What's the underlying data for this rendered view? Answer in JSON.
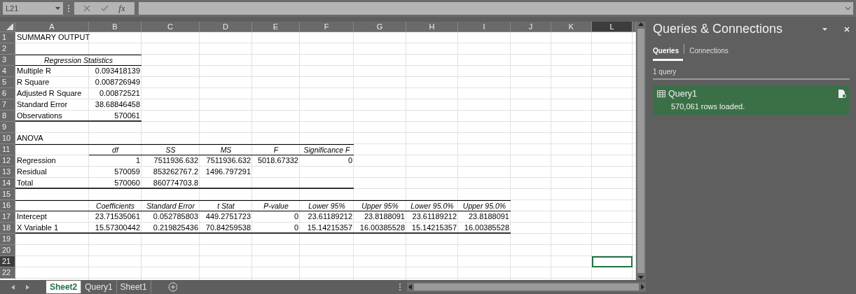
{
  "formula_bar": {
    "name_box": "L21",
    "function_label": "fx"
  },
  "columns": [
    {
      "label": "A",
      "selected": false
    },
    {
      "label": "B",
      "selected": false
    },
    {
      "label": "C",
      "selected": false
    },
    {
      "label": "D",
      "selected": false
    },
    {
      "label": "E",
      "selected": false
    },
    {
      "label": "F",
      "selected": false
    },
    {
      "label": "G",
      "selected": false
    },
    {
      "label": "H",
      "selected": false
    },
    {
      "label": "I",
      "selected": false
    },
    {
      "label": "J",
      "selected": false
    },
    {
      "label": "K",
      "selected": false
    },
    {
      "label": "L",
      "selected": true
    }
  ],
  "rows": [
    {
      "number": "1",
      "selected": false,
      "cells": [
        {
          "kind": "label",
          "text": "SUMMARY OUTPUT",
          "rule_above": false,
          "rule_below": false,
          "heavy_rule_below": false
        }
      ]
    },
    {
      "number": "2",
      "selected": false
    },
    {
      "number": "3",
      "selected": false,
      "cells": [
        {
          "kind": "span-heading",
          "text": "Regression Statistics",
          "rule_above": true,
          "rule_below": true,
          "heavy_rule_below": false
        }
      ]
    },
    {
      "number": "4",
      "selected": false,
      "cells": [
        {
          "kind": "label",
          "text": "Multiple R",
          "rule_above": false,
          "rule_below": false,
          "heavy_rule_below": false
        },
        {
          "kind": "number",
          "text": "0.093418139",
          "rule_above": false,
          "rule_below": false,
          "heavy_rule_below": false
        }
      ]
    },
    {
      "number": "5",
      "selected": false,
      "cells": [
        {
          "kind": "label",
          "text": "R Square",
          "rule_above": false,
          "rule_below": false,
          "heavy_rule_below": false
        },
        {
          "kind": "number",
          "text": "0.008726949",
          "rule_above": false,
          "rule_below": false,
          "heavy_rule_below": false
        }
      ]
    },
    {
      "number": "6",
      "selected": false,
      "cells": [
        {
          "kind": "label",
          "text": "Adjusted R Square",
          "rule_above": false,
          "rule_below": false,
          "heavy_rule_below": false
        },
        {
          "kind": "number",
          "text": "0.00872521",
          "rule_above": false,
          "rule_below": false,
          "heavy_rule_below": false
        }
      ]
    },
    {
      "number": "7",
      "selected": false,
      "cells": [
        {
          "kind": "label",
          "text": "Standard Error",
          "rule_above": false,
          "rule_below": false,
          "heavy_rule_below": false
        },
        {
          "kind": "number",
          "text": "38.68846458",
          "rule_above": false,
          "rule_below": false,
          "heavy_rule_below": false
        }
      ]
    },
    {
      "number": "8",
      "selected": false,
      "cells": [
        {
          "kind": "label",
          "text": "Observations",
          "rule_above": false,
          "rule_below": false,
          "heavy_rule_below": true
        },
        {
          "kind": "number",
          "text": "570061",
          "rule_above": false,
          "rule_below": false,
          "heavy_rule_below": true
        }
      ]
    },
    {
      "number": "9",
      "selected": false
    },
    {
      "number": "10",
      "selected": false,
      "cells": [
        {
          "kind": "label",
          "text": "ANOVA",
          "rule_above": false,
          "rule_below": false,
          "heavy_rule_below": false
        }
      ]
    },
    {
      "number": "11",
      "selected": false,
      "cells": [
        {
          "kind": "blank",
          "rule_above": true,
          "rule_below": false,
          "heavy_rule_below": false
        },
        {
          "kind": "heading",
          "text": "df",
          "rule_above": true,
          "rule_below": true,
          "heavy_rule_below": false
        },
        {
          "kind": "heading",
          "text": "SS",
          "rule_above": true,
          "rule_below": true,
          "heavy_rule_below": false
        },
        {
          "kind": "heading",
          "text": "MS",
          "rule_above": true,
          "rule_below": true,
          "heavy_rule_below": false
        },
        {
          "kind": "heading",
          "text": "F",
          "rule_above": true,
          "rule_below": true,
          "heavy_rule_below": false
        },
        {
          "kind": "heading",
          "text": "Significance F",
          "rule_above": true,
          "rule_below": true,
          "heavy_rule_below": false
        }
      ]
    },
    {
      "number": "12",
      "selected": false,
      "cells": [
        {
          "kind": "label",
          "text": "Regression",
          "rule_above": false,
          "rule_below": false,
          "heavy_rule_below": false
        },
        {
          "kind": "number",
          "text": "1",
          "rule_above": false,
          "rule_below": false,
          "heavy_rule_below": false
        },
        {
          "kind": "number",
          "text": "7511936.632",
          "rule_above": false,
          "rule_below": false,
          "heavy_rule_below": false
        },
        {
          "kind": "number",
          "text": "7511936.632",
          "rule_above": false,
          "rule_below": false,
          "heavy_rule_below": false
        },
        {
          "kind": "number",
          "text": "5018.67332",
          "rule_above": false,
          "rule_below": false,
          "heavy_rule_below": false
        },
        {
          "kind": "number",
          "text": "0",
          "rule_above": false,
          "rule_below": false,
          "heavy_rule_below": false
        }
      ]
    },
    {
      "number": "13",
      "selected": false,
      "cells": [
        {
          "kind": "label",
          "text": "Residual",
          "rule_above": false,
          "rule_below": false,
          "heavy_rule_below": false
        },
        {
          "kind": "number",
          "text": "570059",
          "rule_above": false,
          "rule_below": false,
          "heavy_rule_below": false
        },
        {
          "kind": "number",
          "text": "853262767.2",
          "rule_above": false,
          "rule_below": false,
          "heavy_rule_below": false
        },
        {
          "kind": "number",
          "text": "1496.797291",
          "rule_above": false,
          "rule_below": false,
          "heavy_rule_below": false
        }
      ]
    },
    {
      "number": "14",
      "selected": false,
      "cells": [
        {
          "kind": "label",
          "text": "Total",
          "rule_above": false,
          "rule_below": false,
          "heavy_rule_below": true
        },
        {
          "kind": "number",
          "text": "570060",
          "rule_above": false,
          "rule_below": false,
          "heavy_rule_below": true
        },
        {
          "kind": "number",
          "text": "860774703.8",
          "rule_above": false,
          "rule_below": false,
          "heavy_rule_below": true
        },
        {
          "kind": "blank",
          "rule_above": false,
          "rule_below": false,
          "heavy_rule_below": true
        },
        {
          "kind": "blank",
          "rule_above": false,
          "rule_below": false,
          "heavy_rule_below": true
        },
        {
          "kind": "blank",
          "rule_above": false,
          "rule_below": false,
          "heavy_rule_below": true
        }
      ]
    },
    {
      "number": "15",
      "selected": false
    },
    {
      "number": "16",
      "selected": false,
      "cells": [
        {
          "kind": "blank",
          "rule_above": true,
          "rule_below": true,
          "heavy_rule_below": false
        },
        {
          "kind": "heading",
          "text": "Coefficients",
          "rule_above": true,
          "rule_below": true,
          "heavy_rule_below": false
        },
        {
          "kind": "heading",
          "text": "Standard Error",
          "rule_above": true,
          "rule_below": true,
          "heavy_rule_below": false
        },
        {
          "kind": "heading",
          "text": "t Stat",
          "rule_above": true,
          "rule_below": true,
          "heavy_rule_below": false
        },
        {
          "kind": "heading",
          "text": "P-value",
          "rule_above": true,
          "rule_below": true,
          "heavy_rule_below": false
        },
        {
          "kind": "heading",
          "text": "Lower 95%",
          "rule_above": true,
          "rule_below": true,
          "heavy_rule_below": false
        },
        {
          "kind": "heading",
          "text": "Upper 95%",
          "rule_above": true,
          "rule_below": true,
          "heavy_rule_below": false
        },
        {
          "kind": "heading",
          "text": "Lower 95.0%",
          "rule_above": true,
          "rule_below": true,
          "heavy_rule_below": false
        },
        {
          "kind": "heading",
          "text": "Upper 95.0%",
          "rule_above": true,
          "rule_below": true,
          "heavy_rule_below": false
        }
      ]
    },
    {
      "number": "17",
      "selected": false,
      "cells": [
        {
          "kind": "label",
          "text": "Intercept",
          "rule_above": false,
          "rule_below": false,
          "heavy_rule_below": false
        },
        {
          "kind": "number",
          "text": "23.71535061",
          "rule_above": false,
          "rule_below": false,
          "heavy_rule_below": false
        },
        {
          "kind": "number",
          "text": "0.052785803",
          "rule_above": false,
          "rule_below": false,
          "heavy_rule_below": false
        },
        {
          "kind": "number",
          "text": "449.2751723",
          "rule_above": false,
          "rule_below": false,
          "heavy_rule_below": false
        },
        {
          "kind": "number",
          "text": "0",
          "rule_above": false,
          "rule_below": false,
          "heavy_rule_below": false
        },
        {
          "kind": "number",
          "text": "23.61189212",
          "rule_above": false,
          "rule_below": false,
          "heavy_rule_below": false
        },
        {
          "kind": "number",
          "text": "23.8188091",
          "rule_above": false,
          "rule_below": false,
          "heavy_rule_below": false
        },
        {
          "kind": "number",
          "text": "23.61189212",
          "rule_above": false,
          "rule_below": false,
          "heavy_rule_below": false
        },
        {
          "kind": "number",
          "text": "23.8188091",
          "rule_above": false,
          "rule_below": false,
          "heavy_rule_below": false
        }
      ]
    },
    {
      "number": "18",
      "selected": false,
      "cells": [
        {
          "kind": "label",
          "text": "X Variable 1",
          "rule_above": false,
          "rule_below": false,
          "heavy_rule_below": true
        },
        {
          "kind": "number",
          "text": "15.57300442",
          "rule_above": false,
          "rule_below": false,
          "heavy_rule_below": true
        },
        {
          "kind": "number",
          "text": "0.219825436",
          "rule_above": false,
          "rule_below": false,
          "heavy_rule_below": true
        },
        {
          "kind": "number",
          "text": "70.84259538",
          "rule_above": false,
          "rule_below": false,
          "heavy_rule_below": true
        },
        {
          "kind": "number",
          "text": "0",
          "rule_above": false,
          "rule_below": false,
          "heavy_rule_below": true
        },
        {
          "kind": "number",
          "text": "15.14215357",
          "rule_above": false,
          "rule_below": false,
          "heavy_rule_below": true
        },
        {
          "kind": "number",
          "text": "16.00385528",
          "rule_above": false,
          "rule_below": false,
          "heavy_rule_below": true
        },
        {
          "kind": "number",
          "text": "15.14215357",
          "rule_above": false,
          "rule_below": false,
          "heavy_rule_below": true
        },
        {
          "kind": "number",
          "text": "16.00385528",
          "rule_above": false,
          "rule_below": false,
          "heavy_rule_below": true
        }
      ]
    },
    {
      "number": "19",
      "selected": false
    },
    {
      "number": "20",
      "selected": false
    },
    {
      "number": "21",
      "selected": true
    },
    {
      "number": "22",
      "selected": false
    }
  ],
  "sheet_tabs": [
    {
      "label": "Sheet2",
      "selected": true
    },
    {
      "label": "Query1",
      "selected": false
    },
    {
      "label": "Sheet1",
      "selected": false
    }
  ],
  "panel": {
    "title": "Queries & Connections",
    "tabs": [
      {
        "label": "Queries",
        "selected": true
      },
      {
        "label": "Connections",
        "selected": false
      }
    ],
    "count": "1 query",
    "queries": [
      {
        "name": "Query1",
        "status": "570,061 rows loaded."
      }
    ]
  }
}
